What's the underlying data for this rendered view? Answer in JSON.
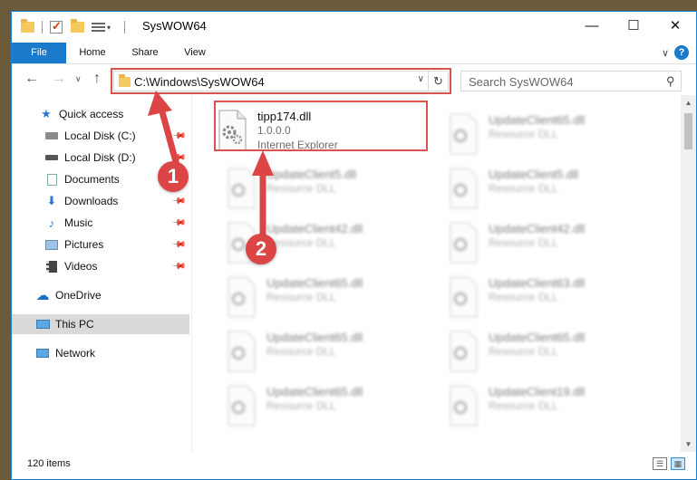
{
  "titlebar": {
    "title": "SysWOW64",
    "minimize": "—",
    "maximize": "☐",
    "close": "✕"
  },
  "ribbon": {
    "tabs": [
      "File",
      "Home",
      "Share",
      "View"
    ],
    "expand": "∨",
    "help": "?"
  },
  "nav": {
    "back": "←",
    "forward": "→",
    "recent": "∨",
    "up": "↑"
  },
  "address": {
    "path": "C:\\Windows\\SysWOW64",
    "dropdown": "∨",
    "refresh": "↻"
  },
  "search": {
    "placeholder": "Search SysWOW64",
    "icon": "⚲"
  },
  "navpane": {
    "items": [
      {
        "label": "Quick access",
        "icon": "star-icon"
      },
      {
        "label": "Local Disk (C:)",
        "icon": "drive-icon",
        "pinned": true
      },
      {
        "label": "Local Disk (D:)",
        "icon": "drive-icon",
        "pinned": true
      },
      {
        "label": "Documents",
        "icon": "documents-icon",
        "pinned": true
      },
      {
        "label": "Downloads",
        "icon": "downloads-icon",
        "pinned": true
      },
      {
        "label": "Music",
        "icon": "music-icon",
        "pinned": true
      },
      {
        "label": "Pictures",
        "icon": "pictures-icon",
        "pinned": true
      },
      {
        "label": "Videos",
        "icon": "videos-icon",
        "pinned": true
      },
      {
        "label": "OneDrive",
        "icon": "cloud-icon"
      },
      {
        "label": "This PC",
        "icon": "computer-icon",
        "selected": true
      },
      {
        "label": "Network",
        "icon": "network-icon"
      }
    ]
  },
  "files": [
    {
      "name": "tipp174.dll",
      "line2": "1.0.0.0",
      "line3": "Internet Explorer",
      "highlight": true
    },
    {
      "name": "UpdateClient65.dll",
      "line2": "Resource DLL"
    },
    {
      "name": "UpdateClient5.dll",
      "line2": "Resource DLL"
    },
    {
      "name": "UpdateClient5.dll",
      "line2": "Resource DLL"
    },
    {
      "name": "UpdateClient42.dll",
      "line2": "Resource DLL"
    },
    {
      "name": "UpdateClient42.dll",
      "line2": "Resource DLL"
    },
    {
      "name": "UpdateClient65.dll",
      "line2": "Resource DLL"
    },
    {
      "name": "UpdateClient63.dll",
      "line2": "Resource DLL"
    },
    {
      "name": "UpdateClient65.dll",
      "line2": "Resource DLL"
    },
    {
      "name": "UpdateClient65.dll",
      "line2": "Resource DLL"
    },
    {
      "name": "UpdateClient65.dll",
      "line2": "Resource DLL"
    },
    {
      "name": "UpdateClient19.dll",
      "line2": "Resource DLL"
    }
  ],
  "status": {
    "count": "120 items"
  },
  "callouts": [
    "1",
    "2"
  ],
  "colors": {
    "accent": "#1979ca",
    "annotation": "#dc4545",
    "selected": "#d9d9d9"
  }
}
